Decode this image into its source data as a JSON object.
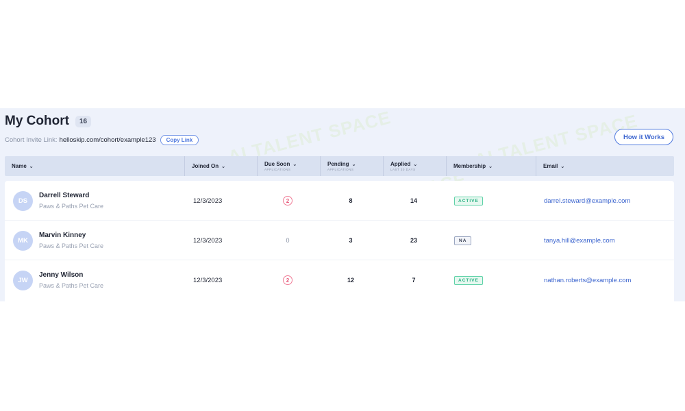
{
  "page": {
    "title": "My Cohort",
    "count": "16",
    "invite_label": "Cohort Invite Link:",
    "invite_link": "helloskip.com/cohort/example123",
    "copy_label": "Copy Link",
    "how_label": "How it Works"
  },
  "watermark": "AI TALENT SPACE",
  "columns": [
    {
      "label": "Name",
      "sub": ""
    },
    {
      "label": "Joined On",
      "sub": ""
    },
    {
      "label": "Due Soon",
      "sub": "APPLICATIONS"
    },
    {
      "label": "Pending",
      "sub": "APPLICATIONS"
    },
    {
      "label": "Applied",
      "sub": "LAST 30 DAYS"
    },
    {
      "label": "Membership",
      "sub": ""
    },
    {
      "label": "Email",
      "sub": ""
    }
  ],
  "rows": [
    {
      "initials": "DS",
      "name": "Darrell Steward",
      "org": "Paws & Paths Pet Care",
      "joined": "12/3/2023",
      "due_soon": "2",
      "pending": "8",
      "applied": "14",
      "membership": "ACTIVE",
      "email": "darrel.steward@example.com"
    },
    {
      "initials": "MK",
      "name": "Marvin Kinney",
      "org": "Paws & Paths Pet Care",
      "joined": "12/3/2023",
      "due_soon": "0",
      "pending": "3",
      "applied": "23",
      "membership": "NA",
      "email": "tanya.hill@example.com"
    },
    {
      "initials": "JW",
      "name": "Jenny Wilson",
      "org": "Paws & Paths Pet Care",
      "joined": "12/3/2023",
      "due_soon": "2",
      "pending": "12",
      "applied": "7",
      "membership": "ACTIVE",
      "email": "nathan.roberts@example.com"
    }
  ],
  "colors": {
    "accent": "#4f79df",
    "panel_bg": "#eef2fb",
    "header_bg": "#d9e1f1",
    "due_ring": "#f07a95",
    "active_green": "#2bb283"
  }
}
